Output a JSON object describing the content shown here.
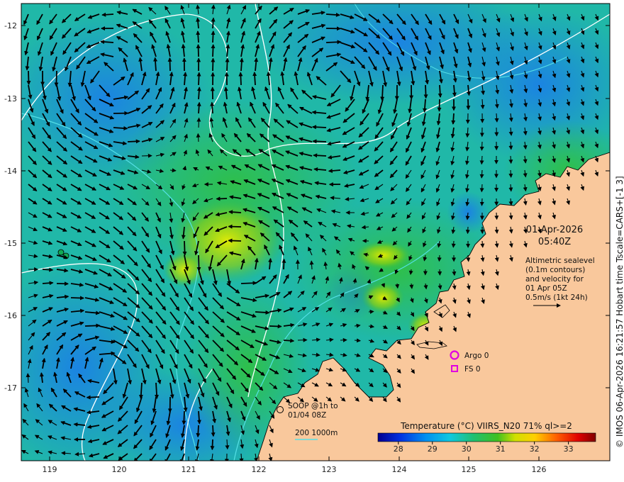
{
  "map": {
    "lat_ticks": [
      "-12",
      "-13",
      "-14",
      "-15",
      "-16",
      "-17"
    ],
    "lon_ticks": [
      "119",
      "120",
      "121",
      "122",
      "123",
      "124",
      "125",
      "126"
    ],
    "date": "01-Apr-2026",
    "time": "05:40Z",
    "info_lines": [
      "Altimetric sealevel",
      "(0.1m contours)",
      "and velocity for",
      "01 Apr 05Z",
      "0.5m/s (1kt 24h)"
    ],
    "legend": {
      "argo_label": "Argo 0",
      "fs_label": "FS 0",
      "soop_lines": [
        "SOOP @1h to",
        "01/04 08Z"
      ],
      "depth_label": "200  1000m"
    },
    "colorbar": {
      "title": "Temperature (°C) VIIRS_N20 71% ql>=2",
      "ticks": [
        "28",
        "29",
        "30",
        "31",
        "32",
        "33"
      ],
      "min": 27.4,
      "max": 33.8
    },
    "credit": "© IMOS 06-Apr-2026 16:21:57 Hobart time Tscale=CARS+[-1 3]",
    "colors": {
      "land": "#f9c89c",
      "sea_warm": "#d8e000",
      "sea_mid": "#1fbf3a",
      "sea_cool": "#1a98e8",
      "contour": "#ffffff",
      "bathymetry": "#55e0e6",
      "marker": "#e000e0"
    }
  }
}
